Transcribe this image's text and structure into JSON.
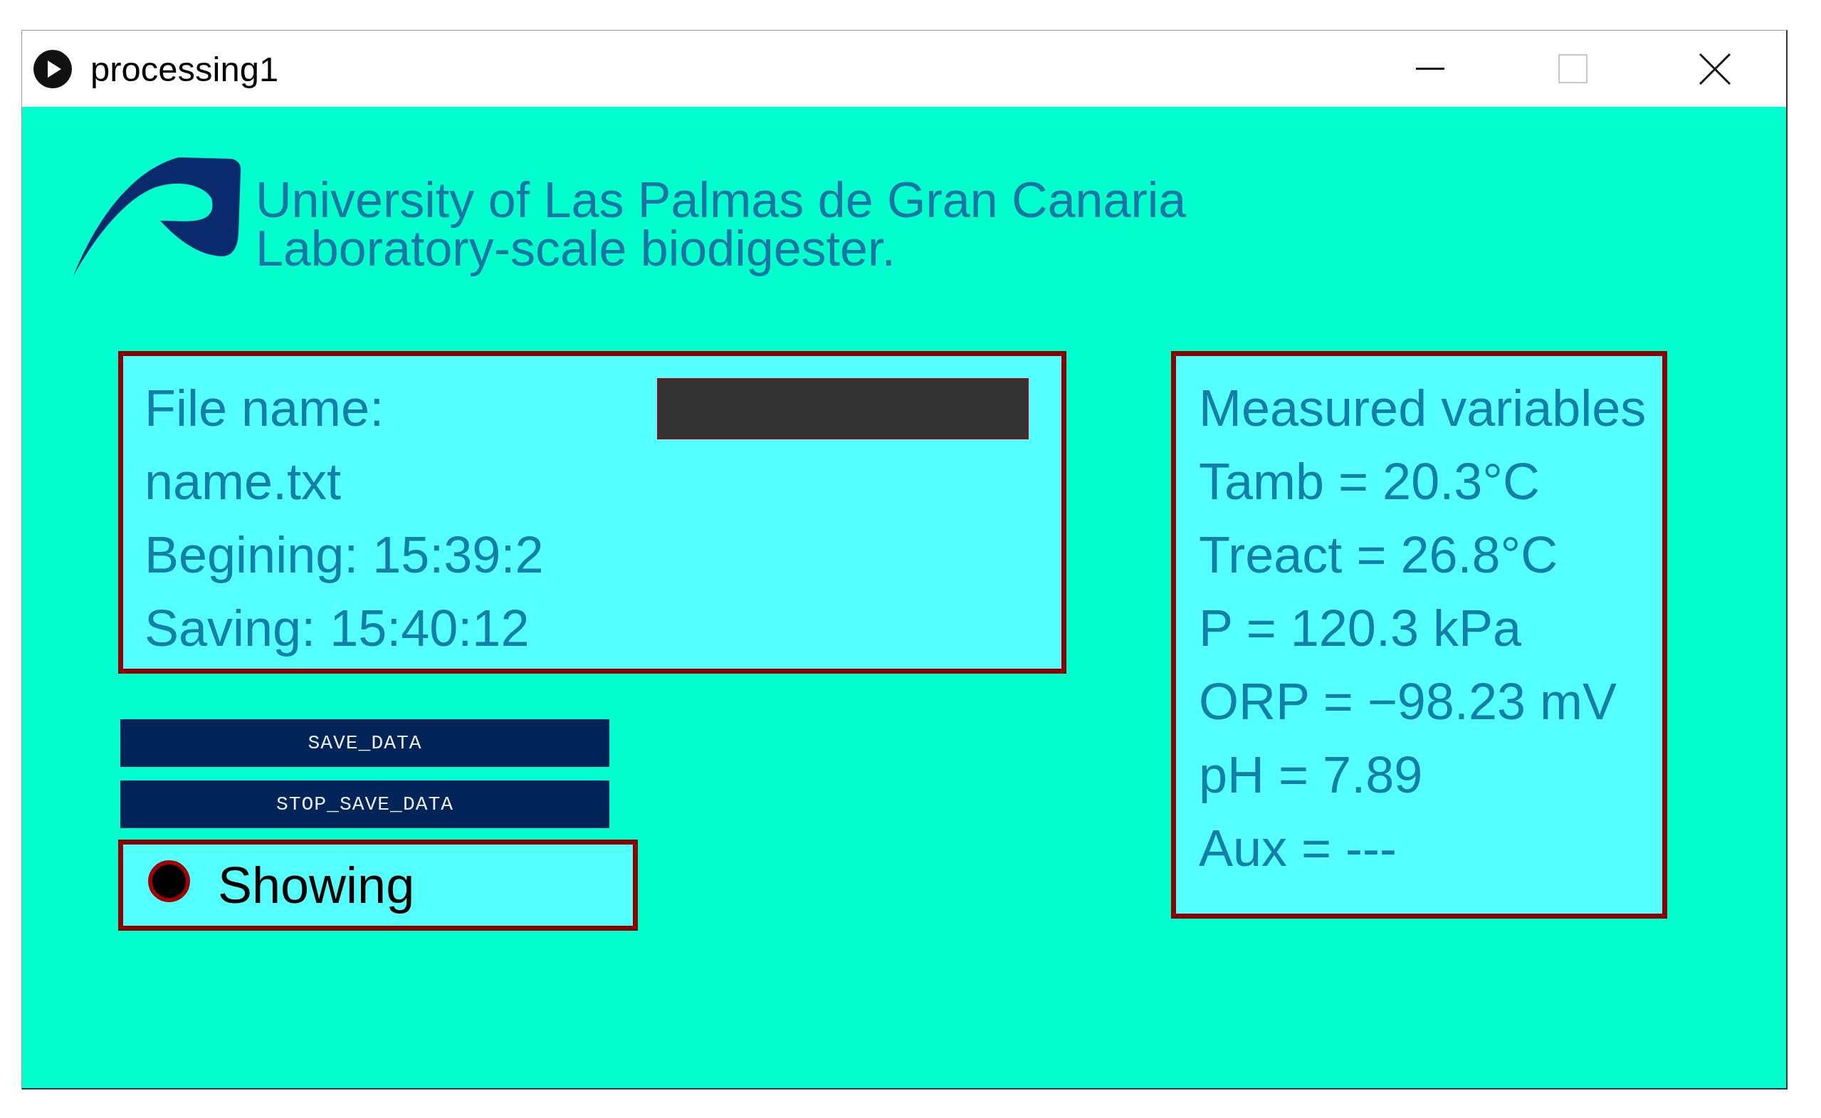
{
  "window": {
    "title": "processing1",
    "controls": [
      {
        "kind": "minimize",
        "disabled": false
      },
      {
        "kind": "maximize",
        "disabled": true
      },
      {
        "kind": "close",
        "disabled": false
      }
    ]
  },
  "header": {
    "lines": [
      "University of Las Palmas de Gran Canaria",
      "Laboratory-scale biodigester."
    ]
  },
  "file_panel": {
    "label": "File name:",
    "file": "name.txt",
    "times": [
      "Begining: 15:39:2",
      "Saving: 15:40:12"
    ]
  },
  "buttons": [
    {
      "label": "SAVE_DATA"
    },
    {
      "label": "STOP_SAVE_DATA"
    }
  ],
  "toggle": {
    "label": "Showing",
    "on": true
  },
  "measurements": {
    "title": "Measured variables",
    "rows": [
      "Tamb = 20.3°C",
      "Treact = 26.8°C",
      "P = 120.3 kPa",
      "ORP = −98.23 mV",
      "pH = 7.89",
      "Aux = ---"
    ]
  }
}
